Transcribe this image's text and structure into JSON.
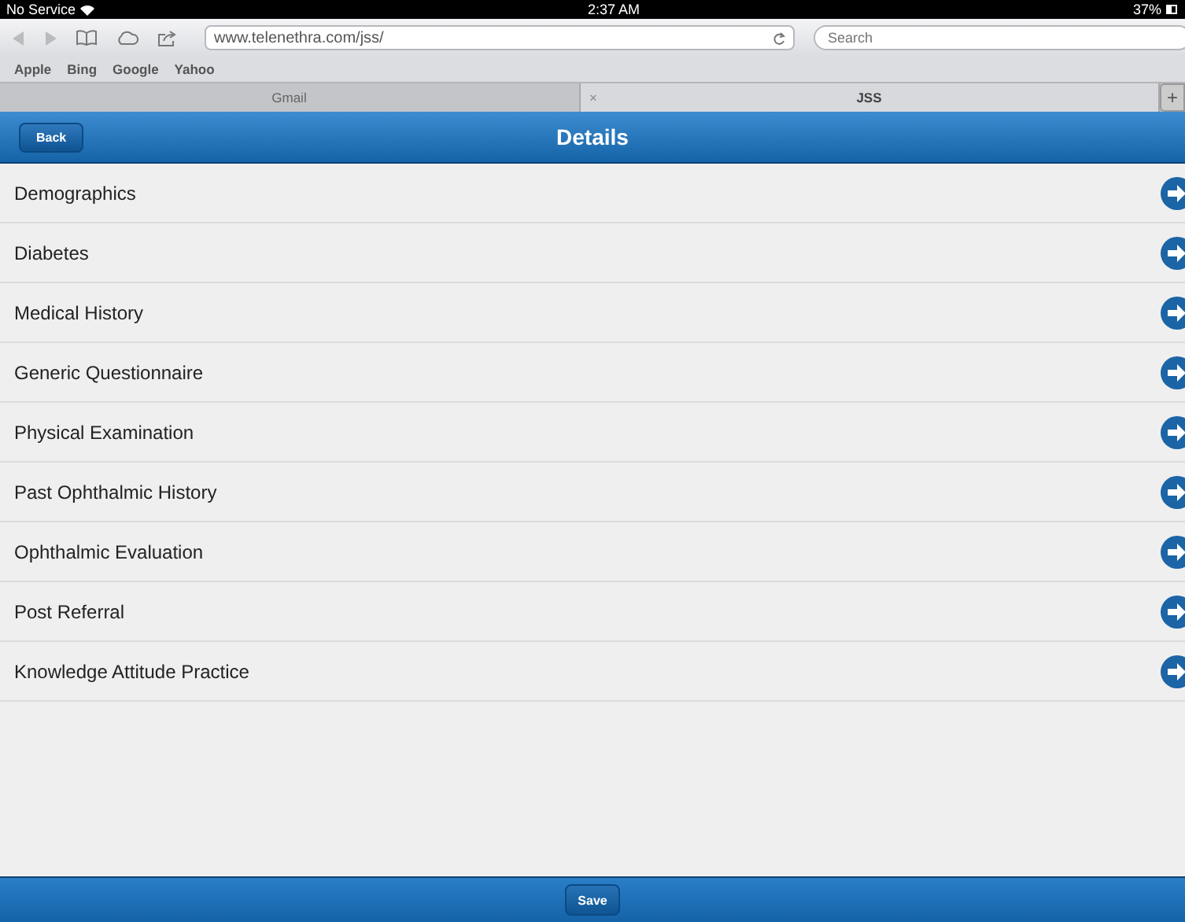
{
  "status_bar": {
    "carrier": "No Service",
    "time": "2:37 AM",
    "battery": "37%"
  },
  "browser": {
    "url": "www.telenethra.com/jss/",
    "search_placeholder": "Search",
    "bookmarks": [
      "Apple",
      "Bing",
      "Google",
      "Yahoo"
    ],
    "tabs": [
      {
        "label": "Gmail",
        "selected": false
      },
      {
        "label": "JSS",
        "selected": true,
        "close": "×"
      }
    ],
    "new_tab": "+"
  },
  "header": {
    "back": "Back",
    "title": "Details"
  },
  "items": [
    "Demographics",
    "Diabetes",
    "Medical History",
    "Generic Questionnaire",
    "Physical Examination",
    "Past Ophthalmic History",
    "Ophthalmic Evaluation",
    "Post Referral",
    "Knowledge Attitude Practice"
  ],
  "footer": {
    "save": "Save"
  }
}
